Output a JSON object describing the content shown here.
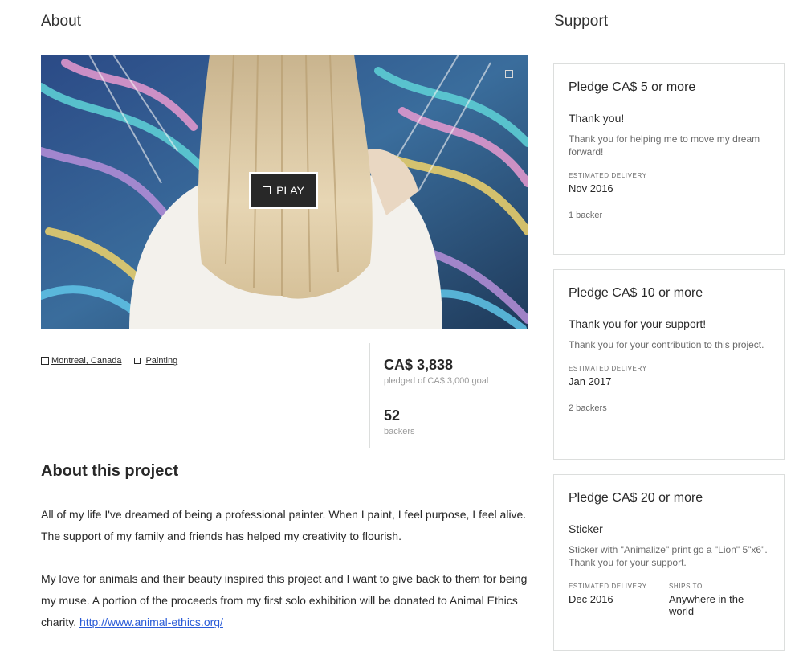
{
  "sections": {
    "about": "About",
    "support": "Support"
  },
  "video": {
    "play_label": "PLAY"
  },
  "tags": {
    "location": "Montreal, Canada",
    "category": "Painting"
  },
  "stats": {
    "pledged_amount": "CA$ 3,838",
    "pledged_caption": "pledged of CA$ 3,000 goal",
    "backers_count": "52",
    "backers_caption": "backers"
  },
  "project": {
    "title": "About this project",
    "para1": "All of my life I've dreamed of being a professional painter. When I paint, I feel purpose, I feel alive. The support of my family and friends has helped my creativity to flourish.",
    "para2": "My love for animals and their beauty inspired this project and I want to give back to them for being my muse. A portion of the proceeds from my first solo exhibition will be donated to Animal Ethics charity.",
    "link": "http://www.animal-ethics.org/"
  },
  "rewards": [
    {
      "title": "Pledge CA$ 5 or more",
      "reward": "Thank you!",
      "description": "Thank you for helping me to move my dream forward!",
      "delivery_label": "Estimated delivery",
      "delivery": "Nov 2016",
      "backers": "1 backer"
    },
    {
      "title": "Pledge CA$ 10 or more",
      "reward": "Thank you for your support!",
      "description": "Thank you for your contribution to this project.",
      "delivery_label": "Estimated delivery",
      "delivery": "Jan 2017",
      "backers": "2 backers"
    },
    {
      "title": "Pledge CA$ 20 or more",
      "reward": "Sticker",
      "description": "Sticker with \"Animalize\" print go a \"Lion\" 5\"x6\".\nThank you for your support.",
      "delivery_label": "Estimated delivery",
      "delivery": "Dec 2016",
      "ships_label": "Ships to",
      "ships": "Anywhere in the world"
    }
  ]
}
